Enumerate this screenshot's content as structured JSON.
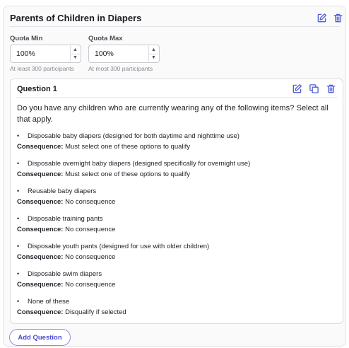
{
  "group": {
    "title": "Parents of Children in Diapers",
    "quota_min": {
      "label": "Quota Min",
      "value": "100%",
      "help": "At least 300 participants"
    },
    "quota_max": {
      "label": "Quota Max",
      "value": "100%",
      "help": "At most 300 participants"
    }
  },
  "question": {
    "title": "Question 1",
    "text": "Do you have any children who are currently wearing any of the following items? Select all that apply.",
    "consequence_label": "Consequence:",
    "options": [
      {
        "label": "Disposable baby diapers (designed for both daytime and nighttime use)",
        "consequence": "Must select one of these options to qualify"
      },
      {
        "label": "Disposable overnight baby diapers (designed specifically for overnight use)",
        "consequence": "Must select one of these options to qualify"
      },
      {
        "label": "Reusable baby diapers",
        "consequence": "No consequence"
      },
      {
        "label": "Disposable training pants",
        "consequence": "No consequence"
      },
      {
        "label": "Disposable youth pants (designed for use with older children)",
        "consequence": "No consequence"
      },
      {
        "label": "Disposable swim diapers",
        "consequence": "No consequence"
      },
      {
        "label": "None of these",
        "consequence": "Disqualify if selected"
      }
    ]
  },
  "add_question_label": "Add Question",
  "colors": {
    "accent": "#4a4ad6",
    "icon": "#4f5bd5"
  }
}
